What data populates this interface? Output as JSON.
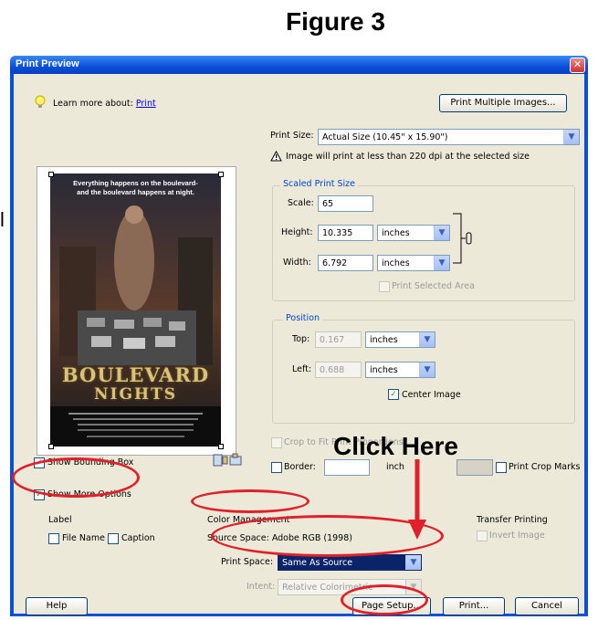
{
  "figure_title": "Figure 3",
  "side_char": "l",
  "dialog": {
    "title": "Print Preview",
    "close_icon": "close-icon",
    "learn_more_prefix": "Learn more about:",
    "learn_more_link": "Print",
    "print_multiple_button": "Print Multiple Images...",
    "print_size_label": "Print Size:",
    "print_size_value": "Actual Size (10.45\" x 15.90\")",
    "warning_text": "Image will print at less than 220 dpi at the selected size",
    "scaled_group_title": "Scaled Print Size",
    "scale_label": "Scale:",
    "scale_value": "65",
    "height_label": "Height:",
    "height_value": "10.335",
    "height_unit": "inches",
    "width_label": "Width:",
    "width_value": "6.792",
    "width_unit": "inches",
    "print_selected_area": "Print Selected Area",
    "position_group_title": "Position",
    "top_label": "Top:",
    "top_value": "0.167",
    "top_unit": "inches",
    "left_label": "Left:",
    "left_value": "0.688",
    "left_unit": "inches",
    "center_image": "Center Image",
    "crop_to_fit": "Crop to Fit Print Proportions",
    "show_bounding_box": "Show Bounding Box",
    "border_label": "Border:",
    "border_unit_partial": "inch",
    "print_crop_marks": "Print Crop Marks",
    "show_more_options": "Show More Options",
    "label_heading": "Label",
    "file_name": "File Name",
    "caption": "Caption",
    "color_management": "Color Management",
    "source_space": "Source Space:  Adobe RGB (1998)",
    "print_space_label": "Print Space:",
    "print_space_value": "Same As Source",
    "intent_label": "Intent:",
    "intent_value": "Relative Colorimetric",
    "transfer_printing": "Transfer Printing",
    "invert_image": "Invert Image",
    "help_button": "Help",
    "page_setup_button": "Page Setup...",
    "print_button": "Print...",
    "cancel_button": "Cancel"
  },
  "poster": {
    "tagline_1": "Everything happens on the boulevard-",
    "tagline_2": "and the boulevard happens at night.",
    "title_1": "BOULEVARD",
    "title_2": "NIGHTS"
  },
  "annotation": {
    "click_here": "Click Here",
    "color": "#e0202a"
  },
  "colors": {
    "titlebar": "#0a4fd9",
    "dialog_bg": "#ece9d8",
    "selected_bg": "#0a246a"
  }
}
